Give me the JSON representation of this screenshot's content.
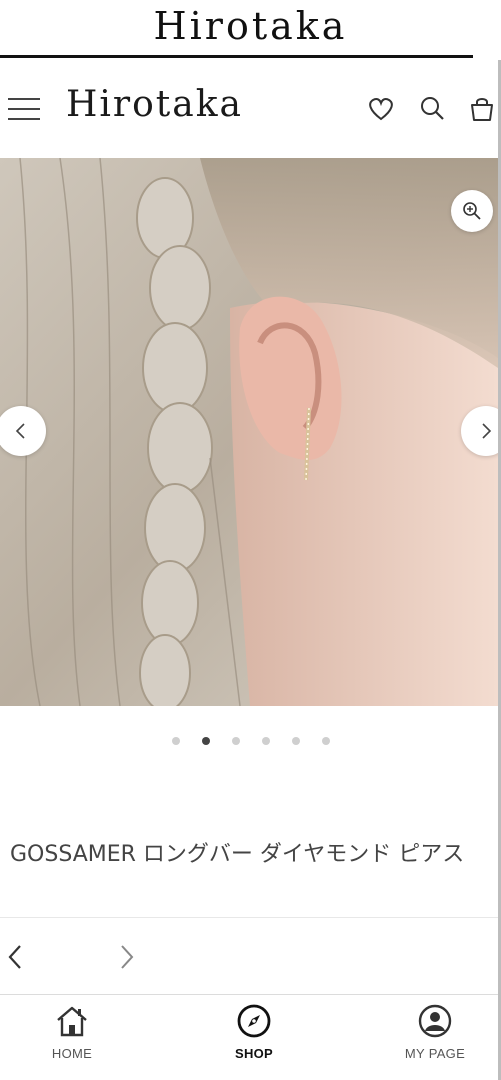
{
  "app": {
    "title": "Hirotaka"
  },
  "header": {
    "logo": "Hirotaka",
    "icons": [
      "menu-icon",
      "heart-icon",
      "search-icon",
      "bag-icon"
    ]
  },
  "gallery": {
    "image_description_icons": [
      "zoom-icon",
      "chevron-left-icon",
      "chevron-right-icon"
    ],
    "dot_count": 6,
    "active_index": 1
  },
  "product": {
    "title": "GOSSAMER ロングバー ダイヤモンド ピアス"
  },
  "bottom_nav": {
    "items": [
      {
        "label": "HOME",
        "icon": "home-icon",
        "active": false
      },
      {
        "label": "SHOP",
        "icon": "compass-icon",
        "active": true
      },
      {
        "label": "MY PAGE",
        "icon": "user-icon",
        "active": false
      }
    ]
  },
  "colors": {
    "text": "#222222",
    "muted": "#555555",
    "dot": "#cfcfcf",
    "dot_active": "#444444"
  }
}
